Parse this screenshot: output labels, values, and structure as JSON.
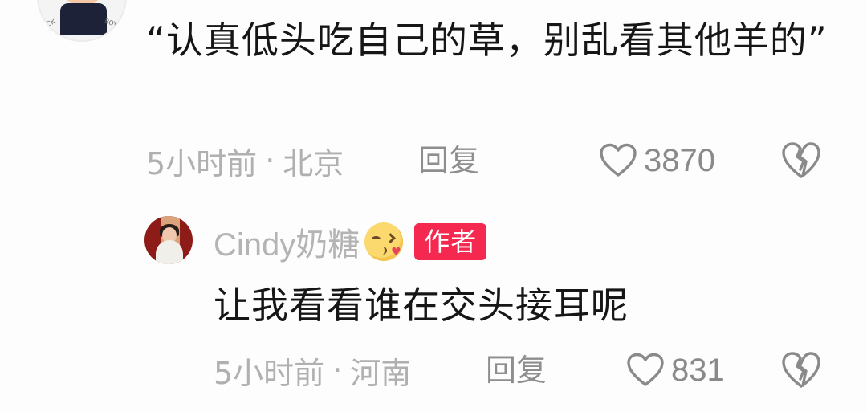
{
  "comment": {
    "avatar_icon": "user-avatar-boy",
    "avatar_text_left": "CK",
    "avatar_text_right": "BOY",
    "text": "“认真低头吃自己的草，别乱看其他羊的”",
    "time": "5小时前",
    "separator": "·",
    "location": "北京",
    "reply_label": "回复",
    "likes": "3870",
    "like_icon": "heart-outline-icon",
    "dislike_icon": "broken-heart-icon"
  },
  "reply": {
    "avatar_icon": "user-avatar-cindy",
    "username": "Cindy奶糖",
    "emoji_icon": "kissing-face-emoji",
    "author_badge": "作者",
    "text": "让我看看谁在交头接耳呢",
    "time": "5小时前",
    "separator": "·",
    "location": "河南",
    "reply_label": "回复",
    "likes": "831",
    "like_icon": "heart-outline-icon",
    "dislike_icon": "broken-heart-icon"
  },
  "colors": {
    "background": "#fdfdfd",
    "primary_text": "#161616",
    "secondary_text": "#b0b0b0",
    "author_badge": "#f5294f"
  }
}
